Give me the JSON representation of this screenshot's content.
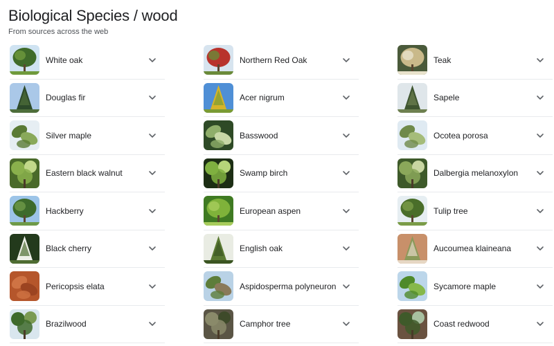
{
  "header": {
    "title": "Biological Species / wood",
    "subtitle": "From sources across the web"
  },
  "columns": [
    {
      "items": [
        {
          "label": "White oak",
          "icon": "white-oak-thumbnail",
          "colors": [
            "#cfe3f2",
            "#3f6b2a",
            "#6f9a3d"
          ]
        },
        {
          "label": "Douglas fir",
          "icon": "douglas-fir-thumbnail",
          "colors": [
            "#aac8e8",
            "#2d4a2a",
            "#4e6e3b"
          ]
        },
        {
          "label": "Silver maple",
          "icon": "silver-maple-thumbnail",
          "colors": [
            "#e6eef3",
            "#5a7a35",
            "#89a95a"
          ]
        },
        {
          "label": "Eastern black walnut",
          "icon": "eastern-black-walnut-thumbnail",
          "colors": [
            "#4a6a2a",
            "#8ab04c",
            "#c2d88a"
          ]
        },
        {
          "label": "Hackberry",
          "icon": "hackberry-thumbnail",
          "colors": [
            "#9cc4e8",
            "#3d6b2b",
            "#6e9a48"
          ]
        },
        {
          "label": "Black cherry",
          "icon": "black-cherry-thumbnail",
          "colors": [
            "#233a1c",
            "#eef0e8",
            "#4f6d33"
          ]
        },
        {
          "label": "Pericopsis elata",
          "icon": "pericopsis-elata-thumbnail",
          "colors": [
            "#b5562b",
            "#cf7344",
            "#9c4421"
          ]
        },
        {
          "label": "Brazilwood",
          "icon": "brazilwood-thumbnail",
          "colors": [
            "#d9e6ee",
            "#3e6a2b",
            "#7a9a52"
          ]
        }
      ]
    },
    {
      "items": [
        {
          "label": "Northern Red Oak",
          "icon": "northern-red-oak-thumbnail",
          "colors": [
            "#d7e4ef",
            "#b8332c",
            "#6a8a3a"
          ]
        },
        {
          "label": "Acer nigrum",
          "icon": "acer-nigrum-thumbnail",
          "colors": [
            "#4f8fd6",
            "#d6b42a",
            "#7a9b34"
          ]
        },
        {
          "label": "Basswood",
          "icon": "basswood-thumbnail",
          "colors": [
            "#2e4a26",
            "#8fae6a",
            "#c8d8a6"
          ]
        },
        {
          "label": "Swamp birch",
          "icon": "swamp-birch-thumbnail",
          "colors": [
            "#1c2e14",
            "#7fb040",
            "#b7d57a"
          ]
        },
        {
          "label": "European aspen",
          "icon": "european-aspen-thumbnail",
          "colors": [
            "#3f7a22",
            "#7fb23a",
            "#a8cc5c"
          ]
        },
        {
          "label": "English oak",
          "icon": "english-oak-thumbnail",
          "colors": [
            "#e9ece3",
            "#5b7a33",
            "#3b5522"
          ]
        },
        {
          "label": "Aspidosperma polyneuron",
          "icon": "aspidosperma-polyneuron-thumbnail",
          "colors": [
            "#b9d2e6",
            "#5d7d3a",
            "#8a7a5a"
          ]
        },
        {
          "label": "Camphor tree",
          "icon": "camphor-tree-thumbnail",
          "colors": [
            "#5a5545",
            "#8a8a6a",
            "#3e4a2a"
          ]
        }
      ]
    },
    {
      "items": [
        {
          "label": "Teak",
          "icon": "teak-thumbnail",
          "colors": [
            "#4a5a3a",
            "#c9b98a",
            "#e8e2cc"
          ]
        },
        {
          "label": "Sapele",
          "icon": "sapele-thumbnail",
          "colors": [
            "#dfe6ea",
            "#3f5530",
            "#6e8050"
          ]
        },
        {
          "label": "Ocotea porosa",
          "icon": "ocotea-porosa-thumbnail",
          "colors": [
            "#dfeaf2",
            "#6f8a4a",
            "#a5bc7a"
          ]
        },
        {
          "label": "Dalbergia melanoxylon",
          "icon": "dalbergia-melanoxylon-thumbnail",
          "colors": [
            "#3e5a2a",
            "#8ba85a",
            "#c8d6a2"
          ]
        },
        {
          "label": "Tulip tree",
          "icon": "tulip-tree-thumbnail",
          "colors": [
            "#e6eef2",
            "#4a6e2a",
            "#7a9c48"
          ]
        },
        {
          "label": "Aucoumea klaineana",
          "icon": "aucoumea-klaineana-thumbnail",
          "colors": [
            "#c8906a",
            "#8b9a5a",
            "#e6d7c4"
          ]
        },
        {
          "label": "Sycamore maple",
          "icon": "sycamore-maple-thumbnail",
          "colors": [
            "#bcd6ea",
            "#4f8a2a",
            "#86b84a"
          ]
        },
        {
          "label": "Coast redwood",
          "icon": "coast-redwood-thumbnail",
          "colors": [
            "#6a5240",
            "#3f5a2a",
            "#a8c0a0"
          ]
        }
      ]
    }
  ],
  "chevron_icon": "chevron-down-icon",
  "colors": {
    "text": "#202124",
    "subtext": "#4d5156",
    "divider": "#e8eaed",
    "chevron": "#5f6368"
  }
}
